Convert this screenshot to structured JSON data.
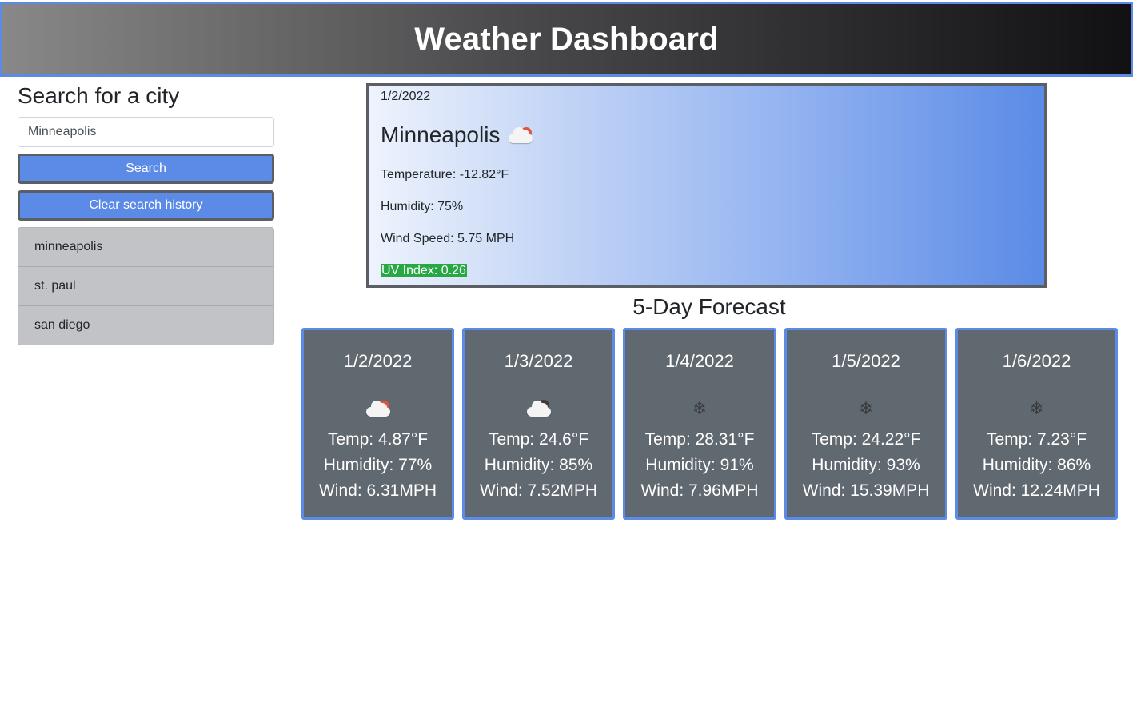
{
  "header": {
    "title": "Weather Dashboard"
  },
  "sidebar": {
    "title": "Search for a city",
    "search_value": "Minneapolis",
    "search_button": "Search",
    "clear_button": "Clear search history",
    "history": [
      "minneapolis",
      "st. paul",
      "san diego"
    ]
  },
  "current": {
    "date": "1/2/2022",
    "city": "Minneapolis",
    "icon": "cloud-sun-icon",
    "temperature": "Temperature: -12.82°F",
    "humidity": "Humidity: 75%",
    "wind": "Wind Speed: 5.75 MPH",
    "uv": "UV Index: 0.26"
  },
  "forecast": {
    "title": "5-Day Forecast",
    "days": [
      {
        "date": "1/2/2022",
        "icon": "cloud-sun-icon",
        "temp": "Temp: 4.87°F",
        "humidity": "Humidity: 77%",
        "wind": "Wind: 6.31MPH"
      },
      {
        "date": "1/3/2022",
        "icon": "cloud-dark-icon",
        "temp": "Temp: 24.6°F",
        "humidity": "Humidity: 85%",
        "wind": "Wind: 7.52MPH"
      },
      {
        "date": "1/4/2022",
        "icon": "snowflake-icon",
        "temp": "Temp: 28.31°F",
        "humidity": "Humidity: 91%",
        "wind": "Wind: 7.96MPH"
      },
      {
        "date": "1/5/2022",
        "icon": "snowflake-icon",
        "temp": "Temp: 24.22°F",
        "humidity": "Humidity: 93%",
        "wind": "Wind: 15.39MPH"
      },
      {
        "date": "1/6/2022",
        "icon": "snowflake-icon",
        "temp": "Temp: 7.23°F",
        "humidity": "Humidity: 86%",
        "wind": "Wind: 12.24MPH"
      }
    ]
  },
  "colors": {
    "accent": "#5b8be6",
    "card_bg": "#616970",
    "uv_badge": "#28a745"
  }
}
